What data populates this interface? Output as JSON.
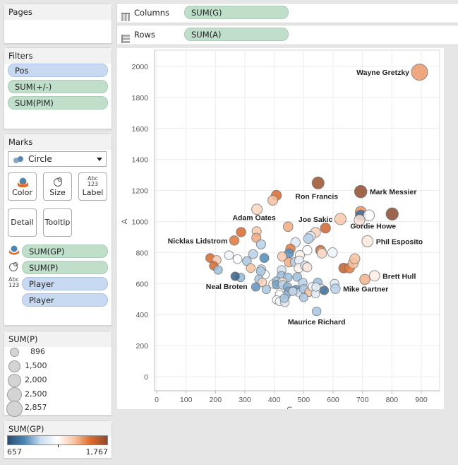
{
  "pages": {
    "title": "Pages"
  },
  "shelves": {
    "columns": {
      "label": "Columns",
      "pill": "SUM(G)"
    },
    "rows": {
      "label": "Rows",
      "pill": "SUM(A)"
    }
  },
  "filters": {
    "title": "Filters",
    "items": [
      {
        "label": "Pos",
        "type": "dimension"
      },
      {
        "label": "SUM(+/-)",
        "type": "measure"
      },
      {
        "label": "SUM(PIM)",
        "type": "measure"
      }
    ]
  },
  "marks": {
    "title": "Marks",
    "mark_type": "Circle",
    "buttons": {
      "color": "Color",
      "size": "Size",
      "label": "Label",
      "detail": "Detail",
      "tooltip": "Tooltip"
    },
    "fields": [
      {
        "encoding": "color",
        "label": "SUM(GP)",
        "type": "measure"
      },
      {
        "encoding": "size",
        "label": "SUM(P)",
        "type": "measure"
      },
      {
        "encoding": "label",
        "label": "Player",
        "type": "dimension"
      },
      {
        "encoding": "detail",
        "label": "Player",
        "type": "dimension"
      }
    ]
  },
  "size_legend": {
    "title": "SUM(P)",
    "items": [
      "896",
      "1,500",
      "2,000",
      "2,500",
      "2,857"
    ]
  },
  "color_legend": {
    "title": "SUM(GP)",
    "min": "657",
    "max": "1,767",
    "colors": [
      "#2c4a6e",
      "#4a87b5",
      "#c9ddef",
      "#ffffff",
      "#f8c3a2",
      "#e06b2b",
      "#8b4a2e"
    ]
  },
  "chart_data": {
    "type": "scatter",
    "title": "",
    "xlabel": "G",
    "ylabel": "A",
    "xlim": [
      0,
      950
    ],
    "ylim": [
      -30,
      2100
    ],
    "xticks": [
      0,
      100,
      200,
      300,
      400,
      500,
      600,
      700,
      800,
      900
    ],
    "yticks": [
      0,
      200,
      400,
      600,
      800,
      1000,
      1200,
      1400,
      1600,
      1800,
      2000
    ],
    "grid": true,
    "color_field": "SUM(GP)",
    "size_field": "SUM(P)",
    "points": [
      {
        "label": "Wayne Gretzky",
        "x": 894,
        "y": 1963,
        "gp": 1487,
        "p": 2857,
        "show": true,
        "pos": "left"
      },
      {
        "label": "Ron Francis",
        "x": 549,
        "y": 1249,
        "gp": 1731,
        "p": 1798,
        "show": true,
        "pos": "below"
      },
      {
        "label": "Mark Messier",
        "x": 694,
        "y": 1193,
        "gp": 1756,
        "p": 1887,
        "show": true,
        "pos": "right"
      },
      {
        "label": "Gordie Howe",
        "x": 801,
        "y": 1049,
        "gp": 1767,
        "p": 1850,
        "show": true,
        "pos": "below-left"
      },
      {
        "label": "Joe Sakic",
        "x": 625,
        "y": 1016,
        "gp": 1378,
        "p": 1641,
        "show": true,
        "pos": "left"
      },
      {
        "label": "Adam Oates",
        "x": 341,
        "y": 1079,
        "gp": 1337,
        "p": 1420,
        "show": true,
        "pos": "below-left"
      },
      {
        "label": "Nicklas Lidstrom",
        "x": 264,
        "y": 878,
        "gp": 1564,
        "p": 1142,
        "show": true,
        "pos": "left"
      },
      {
        "label": "Phil Esposito",
        "x": 717,
        "y": 873,
        "gp": 1282,
        "p": 1590,
        "show": true,
        "pos": "right"
      },
      {
        "label": "Brett Hull",
        "x": 741,
        "y": 650,
        "gp": 1269,
        "p": 1391,
        "show": true,
        "pos": "right"
      },
      {
        "label": "Mike Gartner",
        "x": 708,
        "y": 627,
        "gp": 1432,
        "p": 1335,
        "show": false
      },
      {
        "label": "Mike Gartner",
        "x": 608,
        "y": 567,
        "gp": 1000,
        "p": 1175,
        "show": true,
        "pos": "right"
      },
      {
        "label": "Neal Broten",
        "x": 267,
        "y": 647,
        "gp": 720,
        "p": 923,
        "show": true,
        "pos": "below-left"
      },
      {
        "label": "Maurice Richard",
        "x": 544,
        "y": 421,
        "gp": 978,
        "p": 965,
        "show": true,
        "pos": "below"
      },
      {
        "label": "",
        "x": 407,
        "y": 1169,
        "gp": 1600,
        "p": 1300
      },
      {
        "label": "",
        "x": 395,
        "y": 1137,
        "gp": 1400,
        "p": 1250
      },
      {
        "label": "",
        "x": 694,
        "y": 1063,
        "gp": 1500,
        "p": 1500
      },
      {
        "label": "",
        "x": 694,
        "y": 1040,
        "gp": 760,
        "p": 1480
      },
      {
        "label": "",
        "x": 722,
        "y": 1040,
        "gp": 1200,
        "p": 1500
      },
      {
        "label": "",
        "x": 690,
        "y": 1010,
        "gp": 1300,
        "p": 1450
      },
      {
        "label": "",
        "x": 447,
        "y": 967,
        "gp": 1450,
        "p": 1200
      },
      {
        "label": "",
        "x": 287,
        "y": 932,
        "gp": 1600,
        "p": 1150
      },
      {
        "label": "",
        "x": 340,
        "y": 937,
        "gp": 1380,
        "p": 1100
      },
      {
        "label": "",
        "x": 339,
        "y": 895,
        "gp": 1450,
        "p": 1100
      },
      {
        "label": "",
        "x": 574,
        "y": 958,
        "gp": 1620,
        "p": 1300
      },
      {
        "label": "",
        "x": 540,
        "y": 930,
        "gp": 1350,
        "p": 1280
      },
      {
        "label": "",
        "x": 523,
        "y": 905,
        "gp": 1100,
        "p": 1250
      },
      {
        "label": "",
        "x": 516,
        "y": 890,
        "gp": 1000,
        "p": 1200
      },
      {
        "label": "",
        "x": 355,
        "y": 853,
        "gp": 1000,
        "p": 1100
      },
      {
        "label": "",
        "x": 472,
        "y": 866,
        "gp": 1100,
        "p": 1150
      },
      {
        "label": "",
        "x": 455,
        "y": 825,
        "gp": 1550,
        "p": 1150
      },
      {
        "label": "",
        "x": 450,
        "y": 795,
        "gp": 860,
        "p": 1100
      },
      {
        "label": "",
        "x": 557,
        "y": 815,
        "gp": 1600,
        "p": 1200
      },
      {
        "label": "",
        "x": 560,
        "y": 805,
        "gp": 1450,
        "p": 1200
      },
      {
        "label": "",
        "x": 512,
        "y": 815,
        "gp": 1200,
        "p": 1150
      },
      {
        "label": "",
        "x": 598,
        "y": 800,
        "gp": 1150,
        "p": 1200
      },
      {
        "label": "",
        "x": 562,
        "y": 795,
        "gp": 1300,
        "p": 1180
      },
      {
        "label": "",
        "x": 487,
        "y": 783,
        "gp": 1250,
        "p": 1100
      },
      {
        "label": "",
        "x": 182,
        "y": 765,
        "gp": 1600,
        "p": 1000
      },
      {
        "label": "",
        "x": 204,
        "y": 752,
        "gp": 1380,
        "p": 1000
      },
      {
        "label": "",
        "x": 246,
        "y": 783,
        "gp": 1150,
        "p": 1000
      },
      {
        "label": "",
        "x": 275,
        "y": 758,
        "gp": 1200,
        "p": 1000
      },
      {
        "label": "",
        "x": 328,
        "y": 790,
        "gp": 1000,
        "p": 1050
      },
      {
        "label": "",
        "x": 307,
        "y": 745,
        "gp": 980,
        "p": 1000
      },
      {
        "label": "",
        "x": 366,
        "y": 765,
        "gp": 850,
        "p": 1050
      },
      {
        "label": "",
        "x": 194,
        "y": 715,
        "gp": 1600,
        "p": 950
      },
      {
        "label": "",
        "x": 209,
        "y": 688,
        "gp": 960,
        "p": 950
      },
      {
        "label": "",
        "x": 320,
        "y": 700,
        "gp": 1400,
        "p": 1000
      },
      {
        "label": "",
        "x": 356,
        "y": 693,
        "gp": 1050,
        "p": 1000
      },
      {
        "label": "",
        "x": 368,
        "y": 658,
        "gp": 1200,
        "p": 1000
      },
      {
        "label": "",
        "x": 354,
        "y": 680,
        "gp": 980,
        "p": 1000
      },
      {
        "label": "",
        "x": 427,
        "y": 775,
        "gp": 1380,
        "p": 1100
      },
      {
        "label": "",
        "x": 450,
        "y": 737,
        "gp": 1450,
        "p": 1100
      },
      {
        "label": "",
        "x": 470,
        "y": 738,
        "gp": 1000,
        "p": 1100
      },
      {
        "label": "",
        "x": 485,
        "y": 748,
        "gp": 1150,
        "p": 1100
      },
      {
        "label": "",
        "x": 483,
        "y": 700,
        "gp": 1250,
        "p": 1100
      },
      {
        "label": "",
        "x": 505,
        "y": 716,
        "gp": 1050,
        "p": 1100
      },
      {
        "label": "",
        "x": 512,
        "y": 705,
        "gp": 1280,
        "p": 1100
      },
      {
        "label": "",
        "x": 636,
        "y": 700,
        "gp": 1650,
        "p": 1250
      },
      {
        "label": "",
        "x": 656,
        "y": 700,
        "gp": 1550,
        "p": 1250
      },
      {
        "label": "",
        "x": 668,
        "y": 730,
        "gp": 1400,
        "p": 1300
      },
      {
        "label": "",
        "x": 674,
        "y": 760,
        "gp": 1400,
        "p": 1300
      },
      {
        "label": "",
        "x": 285,
        "y": 640,
        "gp": 950,
        "p": 950
      },
      {
        "label": "",
        "x": 425,
        "y": 688,
        "gp": 1050,
        "p": 1000
      },
      {
        "label": "",
        "x": 424,
        "y": 650,
        "gp": 960,
        "p": 1000
      },
      {
        "label": "",
        "x": 446,
        "y": 640,
        "gp": 960,
        "p": 1000
      },
      {
        "label": "",
        "x": 478,
        "y": 643,
        "gp": 960,
        "p": 1000
      },
      {
        "label": "",
        "x": 348,
        "y": 628,
        "gp": 980,
        "p": 950
      },
      {
        "label": "",
        "x": 359,
        "y": 608,
        "gp": 1350,
        "p": 950
      },
      {
        "label": "",
        "x": 337,
        "y": 578,
        "gp": 870,
        "p": 900
      },
      {
        "label": "",
        "x": 373,
        "y": 562,
        "gp": 980,
        "p": 900
      },
      {
        "label": "",
        "x": 396,
        "y": 598,
        "gp": 1250,
        "p": 950
      },
      {
        "label": "",
        "x": 408,
        "y": 616,
        "gp": 960,
        "p": 950
      },
      {
        "label": "",
        "x": 408,
        "y": 593,
        "gp": 900,
        "p": 950
      },
      {
        "label": "",
        "x": 428,
        "y": 610,
        "gp": 1300,
        "p": 950
      },
      {
        "label": "",
        "x": 428,
        "y": 592,
        "gp": 1000,
        "p": 950
      },
      {
        "label": "",
        "x": 445,
        "y": 578,
        "gp": 930,
        "p": 950
      },
      {
        "label": "",
        "x": 450,
        "y": 550,
        "gp": 900,
        "p": 950
      },
      {
        "label": "",
        "x": 465,
        "y": 553,
        "gp": 800,
        "p": 950
      },
      {
        "label": "",
        "x": 474,
        "y": 562,
        "gp": 870,
        "p": 950
      },
      {
        "label": "",
        "x": 487,
        "y": 540,
        "gp": 1050,
        "p": 950
      },
      {
        "label": "",
        "x": 497,
        "y": 606,
        "gp": 1000,
        "p": 950
      },
      {
        "label": "",
        "x": 500,
        "y": 566,
        "gp": 980,
        "p": 950
      },
      {
        "label": "",
        "x": 518,
        "y": 545,
        "gp": 1400,
        "p": 950
      },
      {
        "label": "",
        "x": 530,
        "y": 580,
        "gp": 1150,
        "p": 950
      },
      {
        "label": "",
        "x": 548,
        "y": 608,
        "gp": 960,
        "p": 950
      },
      {
        "label": "",
        "x": 560,
        "y": 568,
        "gp": 1200,
        "p": 950
      },
      {
        "label": "",
        "x": 570,
        "y": 556,
        "gp": 760,
        "p": 950
      },
      {
        "label": "",
        "x": 605,
        "y": 600,
        "gp": 1100,
        "p": 950
      },
      {
        "label": "",
        "x": 540,
        "y": 535,
        "gp": 1100,
        "p": 900
      },
      {
        "label": "",
        "x": 500,
        "y": 510,
        "gp": 980,
        "p": 900
      },
      {
        "label": "",
        "x": 440,
        "y": 525,
        "gp": 950,
        "p": 900
      },
      {
        "label": "",
        "x": 418,
        "y": 530,
        "gp": 1200,
        "p": 900
      },
      {
        "label": "",
        "x": 408,
        "y": 495,
        "gp": 1200,
        "p": 900
      },
      {
        "label": "",
        "x": 418,
        "y": 485,
        "gp": 1150,
        "p": 900
      },
      {
        "label": "",
        "x": 436,
        "y": 478,
        "gp": 1100,
        "p": 900
      },
      {
        "label": "",
        "x": 434,
        "y": 505,
        "gp": 980,
        "p": 900
      },
      {
        "label": "",
        "x": 463,
        "y": 550,
        "gp": 1050,
        "p": 900
      },
      {
        "label": "",
        "x": 542,
        "y": 578,
        "gp": 1120,
        "p": 900
      }
    ]
  }
}
